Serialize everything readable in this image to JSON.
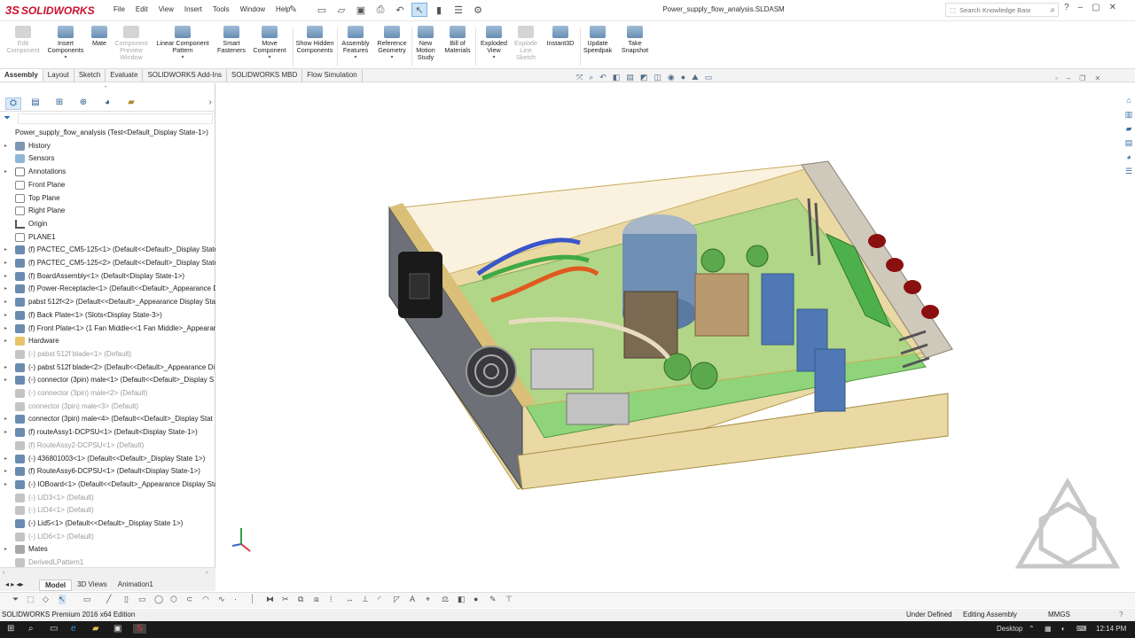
{
  "app": {
    "brand": "SOLIDWORKS",
    "ds_mark": "3S",
    "doc_title": "Power_supply_flow_analysis.SLDASM"
  },
  "menu": [
    "File",
    "Edit",
    "View",
    "Insert",
    "Tools",
    "Window",
    "Help"
  ],
  "search": {
    "placeholder": "Search Knowledge Base"
  },
  "ribbon": [
    {
      "label": "Edit Component",
      "disabled": true
    },
    {
      "label": "Insert Components",
      "disabled": false
    },
    {
      "label": "Mate",
      "disabled": false
    },
    {
      "label": "Component Preview Window",
      "disabled": true
    },
    {
      "label": "Linear Component Pattern",
      "disabled": false
    },
    {
      "label": "Smart Fasteners",
      "disabled": false
    },
    {
      "label": "Move Component",
      "disabled": false
    },
    {
      "label": "Show Hidden Components",
      "disabled": false
    },
    {
      "label": "Assembly Features",
      "disabled": false
    },
    {
      "label": "Reference Geometry",
      "disabled": false
    },
    {
      "label": "New Motion Study",
      "disabled": false
    },
    {
      "label": "Bill of Materials",
      "disabled": false
    },
    {
      "label": "Exploded View",
      "disabled": false
    },
    {
      "label": "Explode Line Sketch",
      "disabled": true
    },
    {
      "label": "Instant3D",
      "disabled": false
    },
    {
      "label": "Update Speedpak",
      "disabled": false
    },
    {
      "label": "Take Snapshot",
      "disabled": false
    }
  ],
  "command_tabs": [
    "Assembly",
    "Layout",
    "Sketch",
    "Evaluate",
    "SOLIDWORKS Add-Ins",
    "SOLIDWORKS MBD",
    "Flow Simulation"
  ],
  "active_command_tab": "Assembly",
  "tree": {
    "root": "Power_supply_flow_analysis  (Test<Default_Display State-1>)",
    "items": [
      {
        "label": "History",
        "icon": "history-icon",
        "exp": true,
        "dim": false
      },
      {
        "label": "Sensors",
        "icon": "sensors-icon",
        "exp": false,
        "dim": false
      },
      {
        "label": "Annotations",
        "icon": "annotations-icon",
        "exp": true,
        "dim": false
      },
      {
        "label": "Front Plane",
        "icon": "plane-icon",
        "exp": false,
        "dim": false
      },
      {
        "label": "Top Plane",
        "icon": "plane-icon",
        "exp": false,
        "dim": false
      },
      {
        "label": "Right Plane",
        "icon": "plane-icon",
        "exp": false,
        "dim": false
      },
      {
        "label": "Origin",
        "icon": "origin-icon",
        "exp": false,
        "dim": false
      },
      {
        "label": "PLANE1",
        "icon": "plane-icon",
        "exp": false,
        "dim": false
      },
      {
        "label": "(f) PACTEC_CM5-125<1> (Default<<Default>_Display State",
        "icon": "part-icon",
        "exp": true,
        "dim": false
      },
      {
        "label": "(f) PACTEC_CM5-125<2> (Default<<Default>_Display State",
        "icon": "part-icon",
        "exp": true,
        "dim": false
      },
      {
        "label": "(f) BoardAssembly<1> (Default<Display State-1>)",
        "icon": "part-icon",
        "exp": true,
        "dim": false
      },
      {
        "label": "(f) Power-Receptacle<1> (Default<<Default>_Appearance D",
        "icon": "part-icon",
        "exp": true,
        "dim": false
      },
      {
        "label": "pabst 512f<2> (Default<<Default>_Appearance Display Stat",
        "icon": "part-icon",
        "exp": true,
        "dim": false
      },
      {
        "label": "(f) Back Plate<1> (Slots<Display State-3>)",
        "icon": "part-icon",
        "exp": true,
        "dim": false
      },
      {
        "label": "(f) Front Plate<1> (1 Fan Middle<<1 Fan Middle>_Appearar",
        "icon": "part-icon",
        "exp": true,
        "dim": false
      },
      {
        "label": "Hardware",
        "icon": "folder-icon",
        "exp": true,
        "dim": false
      },
      {
        "label": "(-) pabst 512f blade<1> (Default)",
        "icon": "part-icon",
        "exp": false,
        "dim": true
      },
      {
        "label": "(-) pabst 512f blade<2> (Default<<Default>_Appearance Di",
        "icon": "part-icon",
        "exp": true,
        "dim": false
      },
      {
        "label": "(-) connector (3pin) male<1> (Default<<Default>_Display S",
        "icon": "part-icon",
        "exp": true,
        "dim": false
      },
      {
        "label": "(-) connector (3pin) male<2> (Default)",
        "icon": "part-icon",
        "exp": false,
        "dim": true
      },
      {
        "label": "connector (3pin) male<3> (Default)",
        "icon": "part-icon",
        "exp": false,
        "dim": true
      },
      {
        "label": "connector (3pin) male<4> (Default<<Default>_Display Stat",
        "icon": "part-icon",
        "exp": true,
        "dim": false
      },
      {
        "label": "(f) routeAssy1-DCPSU<1> (Default<Display State-1>)",
        "icon": "part-icon",
        "exp": true,
        "dim": false
      },
      {
        "label": "(f) RouteAssy2-DCPSU<1> (Default)",
        "icon": "part-icon",
        "exp": false,
        "dim": true
      },
      {
        "label": "(-) 436801003<1> (Default<<Default>_Display State 1>)",
        "icon": "part-icon",
        "exp": true,
        "dim": false
      },
      {
        "label": "(f) RouteAssy6-DCPSU<1> (Default<Display State-1>)",
        "icon": "part-icon",
        "exp": true,
        "dim": false
      },
      {
        "label": "(-) IOBoard<1> (Default<<Default>_Appearance Display Sta",
        "icon": "part-icon",
        "exp": true,
        "dim": false
      },
      {
        "label": "(-) LID3<1> (Default)",
        "icon": "part-icon",
        "exp": false,
        "dim": true
      },
      {
        "label": "(-) LID4<1> (Default)",
        "icon": "part-icon",
        "exp": false,
        "dim": true
      },
      {
        "label": "(-) Lid5<1> (Default<<Default>_Display State 1>)",
        "icon": "part-icon",
        "exp": false,
        "dim": false
      },
      {
        "label": "(-) LID6<1> (Default)",
        "icon": "part-icon",
        "exp": false,
        "dim": true
      },
      {
        "label": "Mates",
        "icon": "mates-icon",
        "exp": true,
        "dim": false
      },
      {
        "label": "DerivedLPattern1",
        "icon": "pattern-icon",
        "exp": false,
        "dim": true
      }
    ]
  },
  "model_tabs": [
    "Model",
    "3D Views",
    "Animation1"
  ],
  "status": {
    "edition": "SOLIDWORKS Premium 2016 x64 Edition",
    "defined": "Under Defined",
    "mode": "Editing Assembly",
    "units": "MMGS"
  },
  "taskbar": {
    "desktop": "Desktop",
    "time": "12:14 PM"
  }
}
